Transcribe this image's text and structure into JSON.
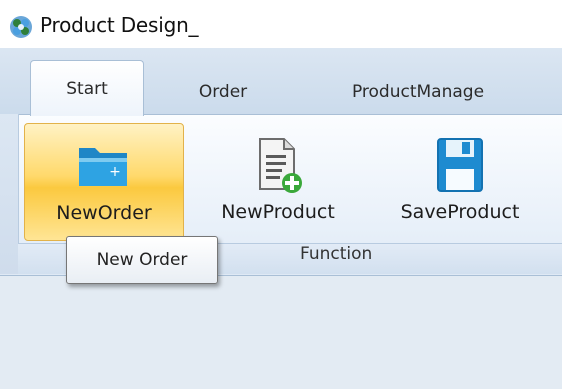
{
  "window": {
    "title": "Product Design_",
    "icon": "app-logo-icon"
  },
  "tabs": [
    {
      "label": "Start",
      "active": true
    },
    {
      "label": "Order",
      "active": false
    },
    {
      "label": "ProductManage",
      "active": false
    }
  ],
  "ribbon": {
    "group_label": "Function",
    "buttons": [
      {
        "label": "NewOrder",
        "icon": "folder-add-icon"
      },
      {
        "label": "NewProduct",
        "icon": "document-add-icon"
      },
      {
        "label": "SaveProduct",
        "icon": "save-disk-icon"
      }
    ]
  },
  "tooltip": {
    "text": "New Order"
  }
}
